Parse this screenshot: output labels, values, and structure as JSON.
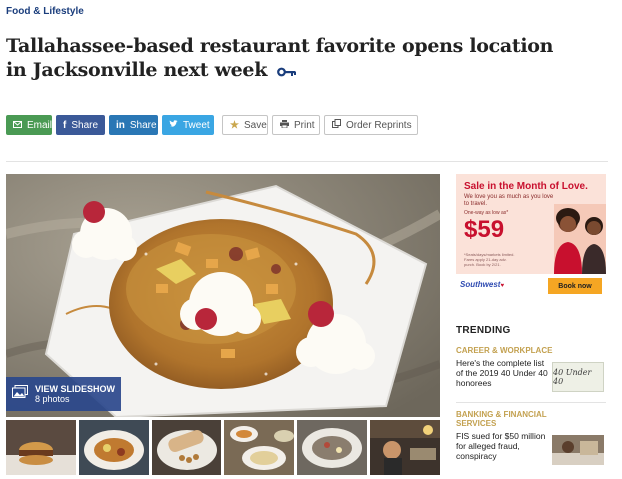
{
  "section": "Food & Lifestyle",
  "headline": "Tallahassee-based restaurant favorite opens location in Jacksonville next week",
  "share": {
    "email": "Email",
    "facebook": "Share",
    "linkedin": "Share",
    "twitter": "Tweet",
    "save": "Save",
    "print": "Print",
    "reprints": "Order Reprints"
  },
  "slideshow": {
    "label": "VIEW SLIDESHOW",
    "count": "8 photos"
  },
  "ad": {
    "title": "Sale in the Month of Love.",
    "subtitle": "We love you as much as you love to travel.",
    "small": "One-way as low as*",
    "price": "$59",
    "fine": "*Seats/days/markets limited. Fares apply 21-day adv. purch. Book by 2/21.",
    "brand": "Southwest",
    "cta": "Book now"
  },
  "trending": {
    "heading": "TRENDING",
    "items": [
      {
        "category": "CAREER & WORKPLACE",
        "text": "Here's the complete list of the 2019 40 Under 40 honorees",
        "thumb_text": "40 Under 40"
      },
      {
        "category": "BANKING & FINANCIAL SERVICES",
        "text": "FIS sued for $50 million for alleged fraud, conspiracy"
      }
    ]
  },
  "colors": {
    "brand_blue": "#1a3d7c",
    "email_green": "#4a9a54",
    "facebook_blue": "#3b5998",
    "linkedin_blue": "#2a77b5",
    "twitter_blue": "#3aa6e3",
    "trending_gold": "#c3a150"
  }
}
